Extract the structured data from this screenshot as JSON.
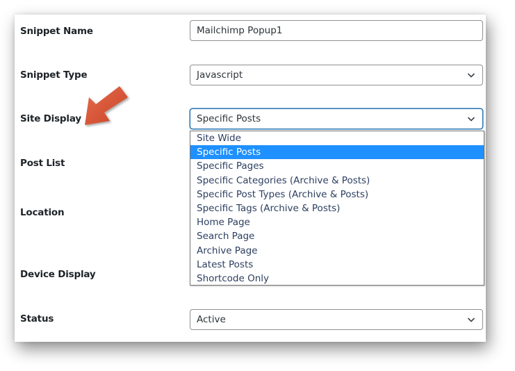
{
  "form": {
    "snippet_name": {
      "label": "Snippet Name",
      "value": "Mailchimp Popup1"
    },
    "snippet_type": {
      "label": "Snippet Type",
      "value": "Javascript"
    },
    "site_display": {
      "label": "Site Display",
      "value": "Specific Posts",
      "options": [
        "Site Wide",
        "Specific Posts",
        "Specific Pages",
        "Specific Categories (Archive & Posts)",
        "Specific Post Types (Archive & Posts)",
        "Specific Tags (Archive & Posts)",
        "Home Page",
        "Search Page",
        "Archive Page",
        "Latest Posts",
        "Shortcode Only"
      ],
      "highlighted_index": 1
    },
    "post_list": {
      "label": "Post List"
    },
    "location": {
      "label": "Location"
    },
    "device_display": {
      "label": "Device Display"
    },
    "status": {
      "label": "Status",
      "value": "Active"
    }
  },
  "annotation": {
    "icon": "arrow-pointer-icon",
    "color": "#d9533a"
  },
  "colors": {
    "focus_border": "#2271b1",
    "highlight": "#1e90ff",
    "option_text": "#2c3e60"
  }
}
